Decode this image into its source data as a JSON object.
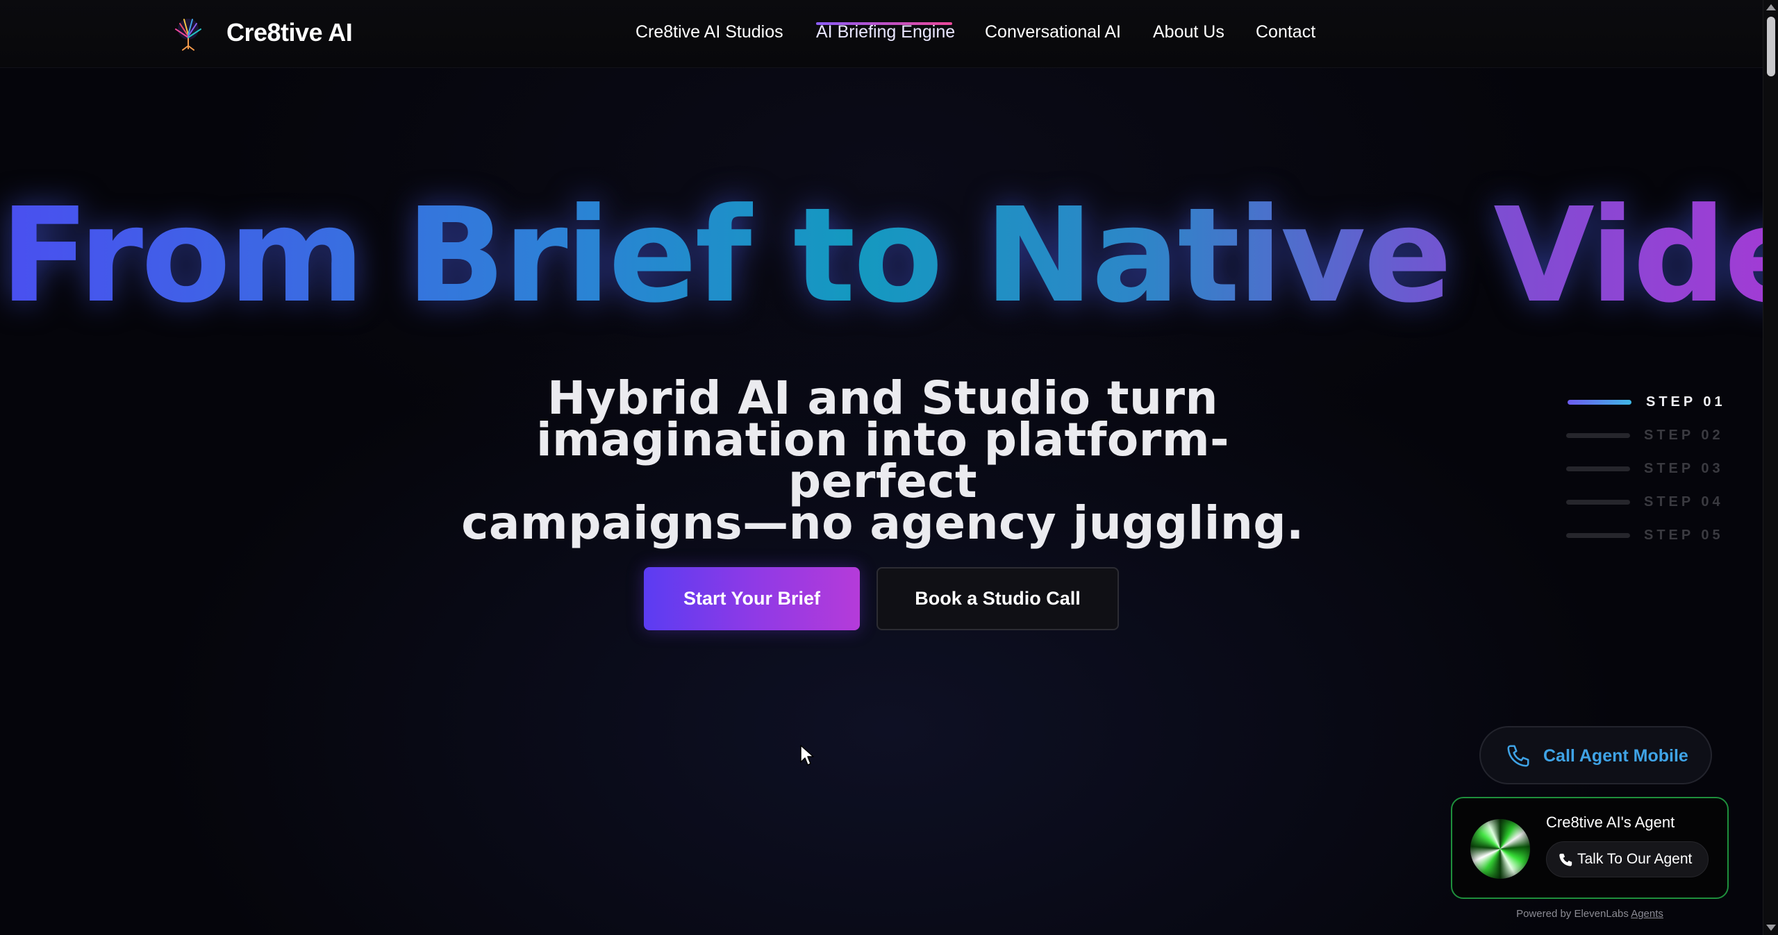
{
  "header": {
    "brand": "Cre8tive AI",
    "nav": [
      {
        "label": "Cre8tive AI Studios"
      },
      {
        "label": "AI Briefing Engine",
        "active": true
      },
      {
        "label": "Conversational AI"
      },
      {
        "label": "About Us"
      },
      {
        "label": "Contact"
      }
    ]
  },
  "hero": {
    "title": "From Brief to Native Video",
    "subtitle_lines": [
      "Hybrid AI and Studio turn",
      "imagination into platform-perfect",
      "campaigns—no agency juggling."
    ],
    "primary_cta": "Start Your Brief",
    "secondary_cta": "Book a Studio Call"
  },
  "steps": {
    "items": [
      "STEP 01",
      "STEP 02",
      "STEP 03",
      "STEP 04",
      "STEP 05"
    ],
    "active_index": 0
  },
  "widgets": {
    "call_mobile": {
      "label": "Call Agent Mobile",
      "icon": "phone-icon"
    },
    "agent": {
      "name": "Cre8tive AI's Agent",
      "talk_label": "Talk To Our Agent",
      "powered_prefix": "Powered by ElevenLabs",
      "powered_link": "Agents"
    }
  },
  "colors": {
    "accent_purple": "#5b3cf2",
    "accent_magenta": "#b53bd9",
    "accent_blue": "#3fa3e6",
    "agent_border": "#1e8f3c",
    "background": "#05050b"
  }
}
